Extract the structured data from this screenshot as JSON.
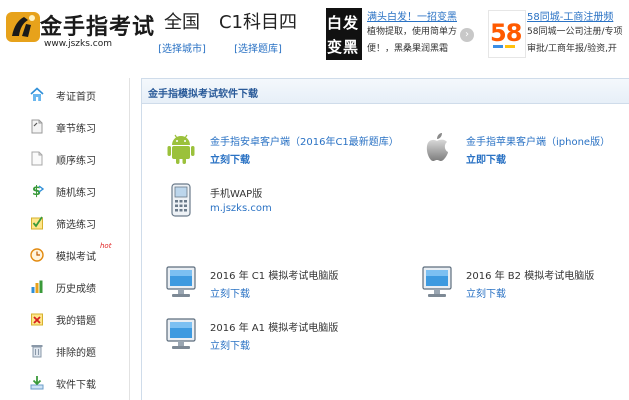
{
  "header": {
    "logo_text": "金手指考试",
    "logo_url": "www.jszks.com",
    "city": {
      "label": "全国",
      "select": "[选择城市]"
    },
    "subject": {
      "label": "C1科目四",
      "select": "[选择题库]"
    },
    "ads": [
      {
        "thumb_text_1": "白发",
        "thumb_text_2": "变黑",
        "title": "满头白发！一招变黑",
        "text": "植物提取，使用简单方便！，黑桑果润黑霜"
      },
      {
        "thumb_text": "58",
        "title": "58同城-工商注册频",
        "text": "58同城一公司注册/专项审批/工商年报/验资,开"
      }
    ],
    "next_glyph": "›"
  },
  "sidebar": {
    "items": [
      {
        "label": "考证首页",
        "icon": "home-icon"
      },
      {
        "label": "章节练习",
        "icon": "chapter-doc-icon"
      },
      {
        "label": "顺序练习",
        "icon": "sequence-doc-icon"
      },
      {
        "label": "随机练习",
        "icon": "random-dollar-icon"
      },
      {
        "label": "筛选练习",
        "icon": "filter-check-icon"
      },
      {
        "label": "模拟考试",
        "icon": "clock-icon",
        "badge": "hot"
      },
      {
        "label": "历史成绩",
        "icon": "bar-chart-icon"
      },
      {
        "label": "我的错题",
        "icon": "wrong-x-icon"
      },
      {
        "label": "排除的题",
        "icon": "trash-icon"
      },
      {
        "label": "软件下载",
        "icon": "download-arrow-icon"
      }
    ]
  },
  "main": {
    "title": "金手指模拟考试软件下载",
    "downloads": {
      "android": {
        "name": "金手指安卓客户端（2016年C1最新题库）",
        "link": "立刻下载",
        "icon": "android-icon"
      },
      "iphone": {
        "name": "金手指苹果客户端（iphone版）",
        "link": "立即下载",
        "icon": "apple-icon"
      },
      "wap": {
        "name": "手机WAP版",
        "link": "m.jszks.com",
        "icon": "mobile-phone-icon"
      },
      "c1": {
        "name": "2016 年 C1 模拟考试电脑版",
        "link": "立刻下载",
        "icon": "desktop-monitor-icon"
      },
      "b2": {
        "name": "2016 年 B2 模拟考试电脑版",
        "link": "立刻下载",
        "icon": "desktop-monitor-icon"
      },
      "a1": {
        "name": "2016 年 A1 模拟考试电脑版",
        "link": "立刻下载",
        "icon": "desktop-monitor-icon"
      }
    }
  },
  "colors": {
    "link_blue": "#2a72c4",
    "title_blue": "#2a5a99",
    "android_green": "#9bc13b",
    "hot_red": "#e02020"
  }
}
